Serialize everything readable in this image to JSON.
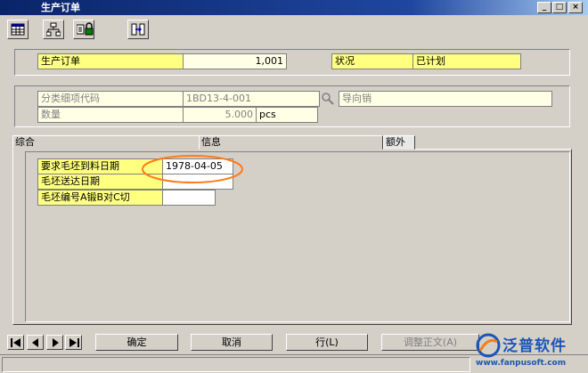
{
  "window": {
    "title": "生产订单",
    "buttons": {
      "minimize": "_",
      "maximize": "□",
      "close": "×"
    }
  },
  "toolbar": {
    "icons": [
      "grid-icon",
      "hierarchy-icon",
      "lock-icon",
      "split-icon"
    ]
  },
  "header": {
    "order_label": "生产订单",
    "order_value": "1,001",
    "status_label": "状况",
    "status_value": "已计划"
  },
  "details": {
    "item_code_label": "分类细项代码",
    "item_code_value": "1BD13-4-001",
    "item_desc": "导向销",
    "quantity_label": "数量",
    "quantity_value": "5.000",
    "quantity_unit": "pcs"
  },
  "tabs": [
    {
      "label": "综合"
    },
    {
      "label": "信息"
    },
    {
      "label": "额外"
    }
  ],
  "extra_fields": [
    {
      "label": "要求毛坯到料日期",
      "value": "1978-04-05"
    },
    {
      "label": "毛坯送达日期",
      "value": ""
    },
    {
      "label": "毛坯编号A锻B对C切",
      "value": ""
    }
  ],
  "bottom": {
    "ok_label": "确定",
    "cancel_label": "取消",
    "row_label": "行(L)",
    "adjust_label": "调整正文(A)"
  },
  "watermark": {
    "brand": "泛普软件",
    "url": "www.fanpusoft.com"
  },
  "colors": {
    "label_yellow": "#ffff80",
    "value_cream": "#ffffe6",
    "highlight_ellipse": "#ff7a1a",
    "title_bar": "#0a246a"
  }
}
